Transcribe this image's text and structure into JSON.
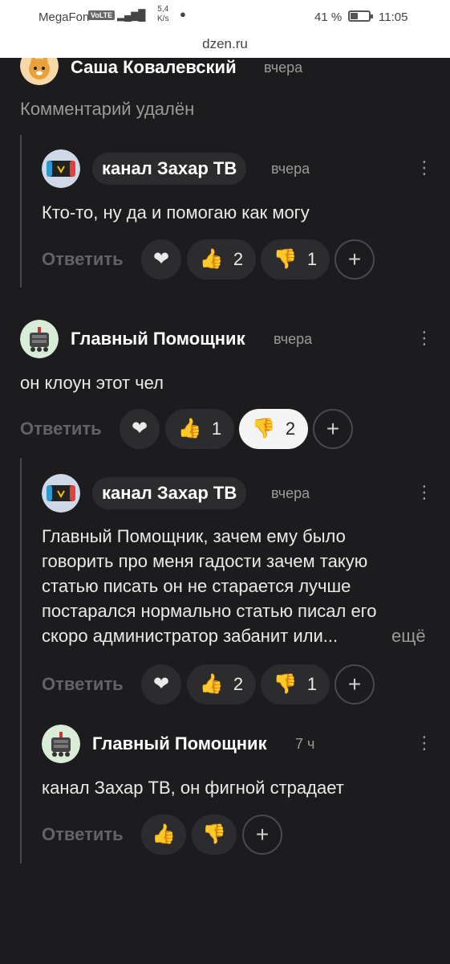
{
  "status_bar": {
    "carrier": "MegaFon",
    "volte": "VoLTE",
    "speed_value": "5,4",
    "speed_unit": "K/s",
    "battery": "41 %",
    "battery_level": 0.41,
    "time": "11:05"
  },
  "url": "dzen.ru",
  "comments": [
    {
      "author": "Саша Ковалевский",
      "time": "вчера",
      "text": "Комментарий удалён"
    },
    {
      "author": "канал Захар ТВ",
      "time": "вчера",
      "text": "Кто-то, ну да и помогаю как могу",
      "reply": "Ответить",
      "likes": "2",
      "dislikes": "1"
    },
    {
      "author": "Главный Помощник",
      "time": "вчера",
      "text": "он клоун этот чел",
      "reply": "Ответить",
      "likes": "1",
      "dislikes": "2"
    },
    {
      "author": "канал Захар ТВ",
      "time": "вчера",
      "text_lines": [
        "Главный Помощник, зачем ему было",
        "говорить про меня гадости зачем такую",
        "статью писать он не старается лучше",
        "постарался нормально статью писал его",
        "скоро администратор забанит или..."
      ],
      "more": "ещё",
      "reply": "Ответить",
      "likes": "2",
      "dislikes": "1"
    },
    {
      "author": "Главный Помощник",
      "time": "7 ч",
      "text": "канал Захар ТВ, он фигной страдает",
      "reply": "Ответить"
    }
  ],
  "icons": {
    "like": "thumbs-up-icon",
    "dislike": "thumbs-down-icon",
    "add_reaction": "plus-icon",
    "author_heart": "author-heart-icon",
    "menu": "more-vertical-icon"
  }
}
